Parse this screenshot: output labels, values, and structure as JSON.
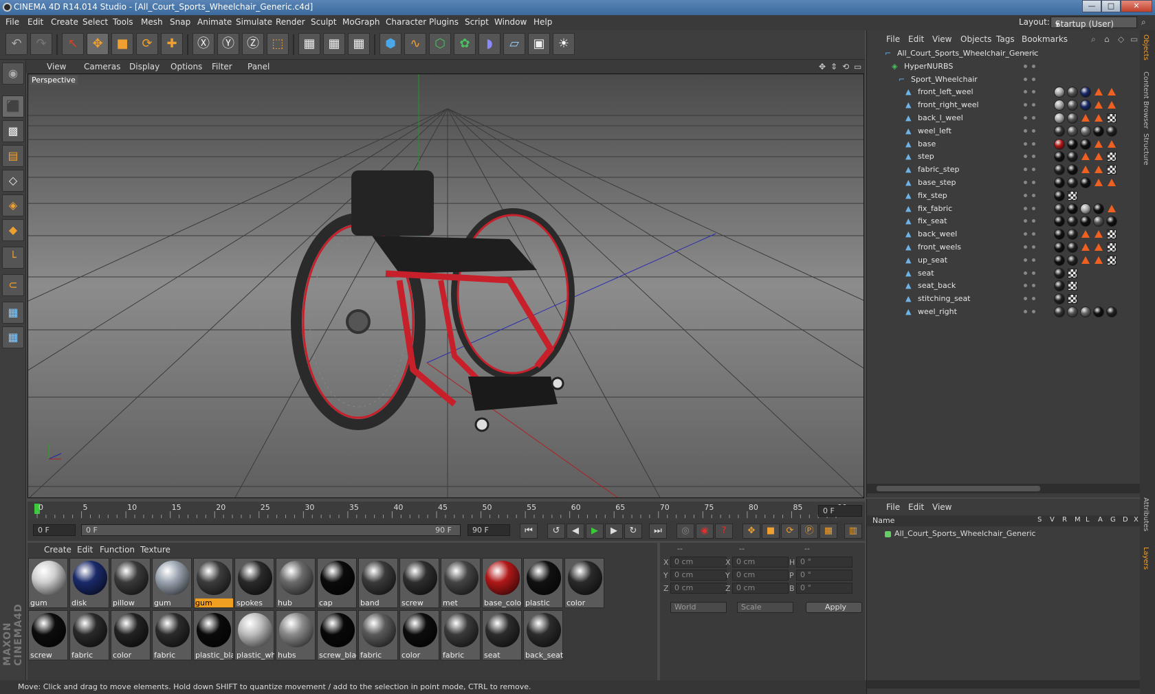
{
  "window": {
    "title": "CINEMA 4D R14.014 Studio - [All_Court_Sports_Wheelchair_Generic.c4d]",
    "controls": [
      "—",
      "□",
      "✕"
    ]
  },
  "menubar": {
    "items": [
      "File",
      "Edit",
      "Create",
      "Select",
      "Tools",
      "Mesh",
      "Snap",
      "Animate",
      "Simulate",
      "Render",
      "Sculpt",
      "MoGraph",
      "Character",
      "Plugins",
      "Script",
      "Window",
      "Help"
    ],
    "layout_label": "Layout:",
    "layout_value": "Startup (User)"
  },
  "toolbar": {
    "icons": [
      "undo-icon",
      "redo-icon",
      "live-selection-icon",
      "move-icon",
      "scale-icon",
      "rotate-icon",
      "add-icon",
      "x-axis-icon",
      "y-axis-icon",
      "z-axis-icon",
      "coordinate-system-icon",
      "render-view-icon",
      "render-picture-viewer-icon",
      "render-settings-icon",
      "cube-icon",
      "spline-icon",
      "nurbs-icon",
      "array-icon",
      "deformer-icon",
      "floor-icon",
      "camera-icon",
      "light-icon"
    ]
  },
  "viewport": {
    "menu": [
      "View",
      "Cameras",
      "Display",
      "Options",
      "Filter",
      "Panel"
    ],
    "label": "Perspective"
  },
  "timeline": {
    "ticks": [
      "0",
      "5",
      "10",
      "15",
      "20",
      "25",
      "30",
      "35",
      "40",
      "45",
      "50",
      "55",
      "60",
      "65",
      "70",
      "75",
      "80",
      "85",
      "90"
    ],
    "current_frame": "0 F",
    "start": "0 F",
    "range_start": "0 F",
    "range_end": "90 F",
    "end": "90 F",
    "progress": 0.0
  },
  "materials": {
    "menu": [
      "Create",
      "Edit",
      "Function",
      "Texture"
    ],
    "row1": [
      {
        "name": "gum",
        "color": "#cfcfcf"
      },
      {
        "name": "disk",
        "color": "#1a2a6a"
      },
      {
        "name": "pillow",
        "color": "#3a3a3a"
      },
      {
        "name": "gum",
        "color": "#9aa4b0"
      },
      {
        "name": "gum",
        "color": "#3c3c3c"
      },
      {
        "name": "spokes",
        "color": "#2a2a2a"
      },
      {
        "name": "hub",
        "color": "#6a6a6a"
      },
      {
        "name": "cap",
        "color": "#0a0a0a"
      },
      {
        "name": "band",
        "color": "#3a3a3a"
      },
      {
        "name": "screw",
        "color": "#2e2e2e"
      },
      {
        "name": "met",
        "color": "#444444"
      },
      {
        "name": "base_color",
        "color": "#b01818"
      },
      {
        "name": "plastic",
        "color": "#111111"
      },
      {
        "name": "color",
        "color": "#2a2a2a"
      }
    ],
    "row2": [
      {
        "name": "screw",
        "color": "#0c0c0c"
      },
      {
        "name": "fabric",
        "color": "#2a2a2a"
      },
      {
        "name": "color",
        "color": "#222222"
      },
      {
        "name": "fabric",
        "color": "#2b2b2b"
      },
      {
        "name": "plastic_blac",
        "color": "#0a0a0a"
      },
      {
        "name": "plastic_whi",
        "color": "#bdbdbd"
      },
      {
        "name": "hubs",
        "color": "#8a8a8a"
      },
      {
        "name": "screw_blac",
        "color": "#080808"
      },
      {
        "name": "fabric",
        "color": "#5a5a5a"
      },
      {
        "name": "color",
        "color": "#0c0c0c"
      },
      {
        "name": "fabric",
        "color": "#3a3a3a"
      },
      {
        "name": "seat",
        "color": "#2c2c2c"
      },
      {
        "name": "back_seat",
        "color": "#2c2c2c"
      }
    ],
    "selected_index": 4
  },
  "coords": {
    "headers": [
      "--",
      "--",
      "--"
    ],
    "rows": [
      {
        "a": "X",
        "av": "0 cm",
        "b": "X",
        "bv": "0 cm",
        "c": "H",
        "cv": "0 °"
      },
      {
        "a": "Y",
        "av": "0 cm",
        "b": "Y",
        "bv": "0 cm",
        "c": "P",
        "cv": "0 °"
      },
      {
        "a": "Z",
        "av": "0 cm",
        "b": "Z",
        "bv": "0 cm",
        "c": "B",
        "cv": "0 °"
      }
    ],
    "mode1": "World",
    "mode2": "Scale",
    "apply": "Apply"
  },
  "status": "Move: Click and drag to move elements. Hold down SHIFT to quantize movement / add to the selection in point mode, CTRL to remove.",
  "objmgr": {
    "menu": [
      "File",
      "Edit",
      "View",
      "Objects",
      "Tags",
      "Bookmarks"
    ],
    "objects": [
      {
        "name": "All_Court_Sports_Wheelchair_Generic",
        "level": 0
      },
      {
        "name": "HyperNURBS",
        "level": 1
      },
      {
        "name": "Sport_Wheelchair",
        "level": 2
      },
      {
        "name": "front_left_weel",
        "level": 3
      },
      {
        "name": "front_right_weel",
        "level": 3
      },
      {
        "name": "back_l_weel",
        "level": 3
      },
      {
        "name": "weel_left",
        "level": 3
      },
      {
        "name": "base",
        "level": 3
      },
      {
        "name": "step",
        "level": 3
      },
      {
        "name": "fabric_step",
        "level": 3
      },
      {
        "name": "base_step",
        "level": 3
      },
      {
        "name": "fix_step",
        "level": 3
      },
      {
        "name": "fix_fabric",
        "level": 3
      },
      {
        "name": "fix_seat",
        "level": 3
      },
      {
        "name": "back_weel",
        "level": 3
      },
      {
        "name": "front_weels",
        "level": 3
      },
      {
        "name": "up_seat",
        "level": 3
      },
      {
        "name": "seat",
        "level": 3
      },
      {
        "name": "seat_back",
        "level": 3
      },
      {
        "name": "stitching_seat",
        "level": 3
      },
      {
        "name": "weel_right",
        "level": 3
      }
    ]
  },
  "layermgr": {
    "menu": [
      "File",
      "Edit",
      "View"
    ],
    "columns": [
      "Name",
      "S",
      "V",
      "R",
      "M",
      "L",
      "A",
      "G",
      "D",
      "X"
    ],
    "layers": [
      "All_Court_Sports_Wheelchair_Generic"
    ]
  },
  "rightstrip": [
    "Objects",
    "Content Browser",
    "Structure",
    "Attributes",
    "Layers"
  ],
  "colors": {
    "accent": "#f0a020",
    "red_frame": "#c8202a"
  }
}
